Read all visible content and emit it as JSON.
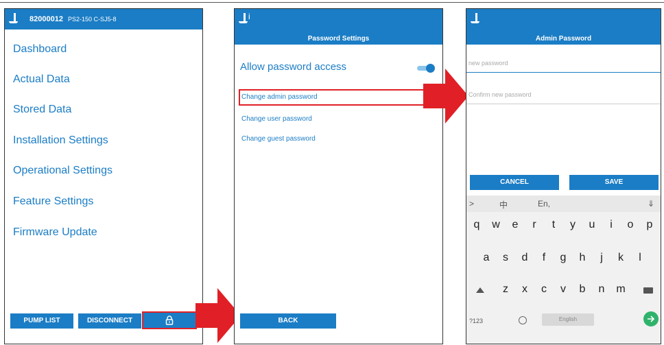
{
  "screen1": {
    "device_id": "82000012",
    "model": "PS2-150 C-SJ5-8",
    "menu": [
      "Dashboard",
      "Actual Data",
      "Stored Data",
      "Installation Settings",
      "Operational Settings",
      "Feature Settings",
      "Firmware Update"
    ],
    "buttons": {
      "pump_list": "PUMP LIST",
      "disconnect": "DISCONNECT"
    },
    "lock_icon": "lock-icon"
  },
  "screen2": {
    "app_initial": "i",
    "title": "Password Settings",
    "allow_label": "Allow password access",
    "allow_enabled": true,
    "links": [
      "Change admin password",
      "Change user password",
      "Change guest password"
    ],
    "back_label": "BACK"
  },
  "screen3": {
    "title": "Admin Password",
    "new_placeholder": "new password",
    "confirm_placeholder": "Confirm new password",
    "cancel_label": "CANCEL",
    "save_label": "SAVE",
    "keyboard": {
      "top_row": [
        ">",
        "中",
        "En,",
        "⇓"
      ],
      "row1": [
        "q",
        "w",
        "e",
        "r",
        "t",
        "y",
        "u",
        "i",
        "o",
        "p"
      ],
      "row2": [
        "a",
        "s",
        "d",
        "f",
        "g",
        "h",
        "j",
        "k",
        "l"
      ],
      "row3": [
        "z",
        "x",
        "c",
        "v",
        "b",
        "n",
        "m"
      ],
      "num_key": "?123",
      "space_label": "English",
      "go_icon": "arrow-right-icon"
    }
  },
  "colors": {
    "accent": "#1b7dc5",
    "highlight": "#e02026"
  }
}
